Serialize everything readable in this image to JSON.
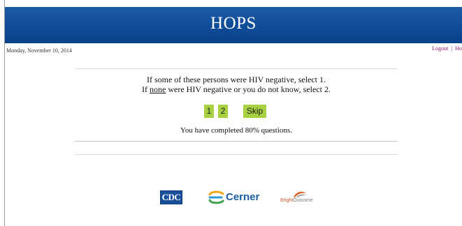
{
  "header": {
    "title": "HOPS",
    "color": "#0f4c98"
  },
  "date": "Monday, November 10, 2014",
  "nav": {
    "logout": "Logout",
    "separator": "|",
    "home": "Hom"
  },
  "question": {
    "line1": "If some of these persons were HIV negative, select 1.",
    "line2_prefix": "If ",
    "line2_underlined": "none",
    "line2_suffix": " were HIV negative or you do not know, select 2."
  },
  "answers": {
    "option1": "1",
    "option2": "2",
    "skip": "Skip",
    "button_color": "#a8d142"
  },
  "progress": {
    "text": "You have completed 80% questions.",
    "percent": 80
  },
  "logos": {
    "cdc": "CDC",
    "cerner": "Cerner",
    "bright_part1": "Bright",
    "bright_part2": "Outcome"
  }
}
